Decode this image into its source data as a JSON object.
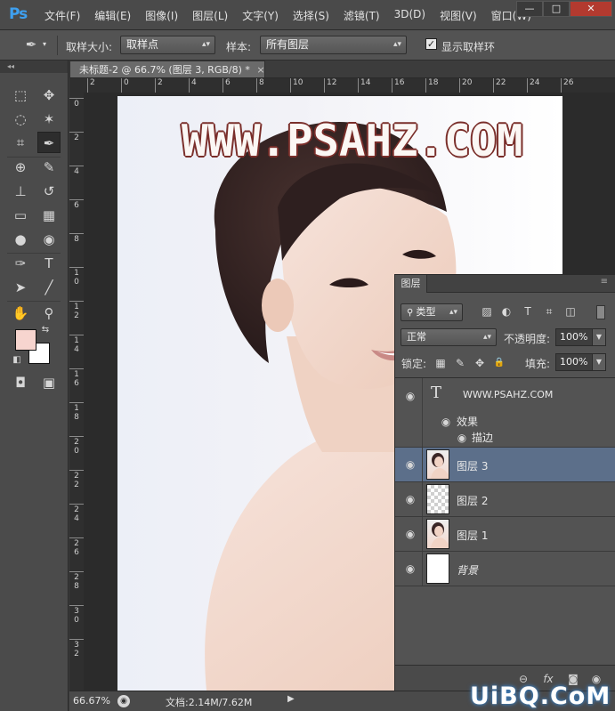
{
  "app": {
    "logo": "Ps",
    "menu": [
      "文件(F)",
      "编辑(E)",
      "图像(I)",
      "图层(L)",
      "文字(Y)",
      "选择(S)",
      "滤镜(T)",
      "3D(D)",
      "视图(V)",
      "窗口(W)"
    ],
    "window_controls": {
      "minimize": "—",
      "maximize": "□",
      "close": "✕"
    }
  },
  "options_bar": {
    "sample_size_label": "取样大小:",
    "sample_size_value": "取样点",
    "sample_label": "样本:",
    "sample_value": "所有图层",
    "show_ring_checked": true,
    "show_ring_label": "显示取样环"
  },
  "tools": {
    "panel_collapse": "◂◂",
    "items": [
      {
        "name": "marquee",
        "glyph": "⬚"
      },
      {
        "name": "move",
        "glyph": "✥"
      },
      {
        "name": "lasso",
        "glyph": "◌"
      },
      {
        "name": "magic-wand",
        "glyph": "✶"
      },
      {
        "name": "crop",
        "glyph": "⌗"
      },
      {
        "name": "eyedropper",
        "glyph": "✒"
      },
      {
        "name": "healing-brush",
        "glyph": "⊕"
      },
      {
        "name": "brush",
        "glyph": "✎"
      },
      {
        "name": "clone-stamp",
        "glyph": "⊥"
      },
      {
        "name": "history-brush",
        "glyph": "↺"
      },
      {
        "name": "eraser",
        "glyph": "▭"
      },
      {
        "name": "gradient",
        "glyph": "▦"
      },
      {
        "name": "blur",
        "glyph": "●"
      },
      {
        "name": "dodge",
        "glyph": "◉"
      },
      {
        "name": "pen",
        "glyph": "✑"
      },
      {
        "name": "type",
        "glyph": "T"
      },
      {
        "name": "path-selection",
        "glyph": "➤"
      },
      {
        "name": "line",
        "glyph": "╱"
      },
      {
        "name": "hand",
        "glyph": "✋"
      },
      {
        "name": "zoom",
        "glyph": "⚲"
      }
    ],
    "foreground_color": "#f7d5cf",
    "background_color": "#ffffff",
    "swap_glyph": "⇆",
    "default_glyph": "◧",
    "quick_mask_glyph": "◘",
    "screen_mode_glyph": "▣"
  },
  "document": {
    "tab_title": "未标题-2 @ 66.7% (图层 3, RGB/8) *",
    "tab_close": "×",
    "ruler_h": [
      "2",
      "0",
      "2",
      "4",
      "6",
      "8",
      "10",
      "12",
      "14",
      "16",
      "18",
      "20",
      "22",
      "24",
      "26"
    ],
    "ruler_v": [
      "0",
      "2",
      "4",
      "6",
      "8",
      "1\n0",
      "1\n2",
      "1\n4",
      "1\n6",
      "1\n8",
      "2\n0",
      "2\n2",
      "2\n4",
      "2\n6",
      "2\n8",
      "3\n0",
      "3\n2"
    ],
    "watermark": "WWW.PSAHZ.COM"
  },
  "status": {
    "zoom": "66.67%",
    "doc_size": "文档:2.14M/7.62M",
    "arrow": "▶",
    "site_logo": "UiBQ.CoM"
  },
  "layers_panel": {
    "tab": "图层",
    "filter_type": "类型",
    "filter_icons": [
      "▨",
      "◐",
      "T",
      "⌗",
      "◫"
    ],
    "blend_mode": "正常",
    "opacity_label": "不透明度:",
    "opacity_value": "100%",
    "lock_label": "锁定:",
    "lock_icons": [
      "▦",
      "✎",
      "✥",
      "🔒"
    ],
    "fill_label": "填充:",
    "fill_value": "100%",
    "layers": [
      {
        "name": "WWW.PSAHZ.COM",
        "kind": "text",
        "effects_label": "效果",
        "effect": "描边"
      },
      {
        "name": "图层 3",
        "kind": "photo",
        "selected": true
      },
      {
        "name": "图层 2",
        "kind": "empty"
      },
      {
        "name": "图层 1",
        "kind": "photo"
      },
      {
        "name": "背景",
        "kind": "background"
      }
    ],
    "bottom_icons": [
      "⊖",
      "fx",
      "◙",
      "◉"
    ]
  }
}
